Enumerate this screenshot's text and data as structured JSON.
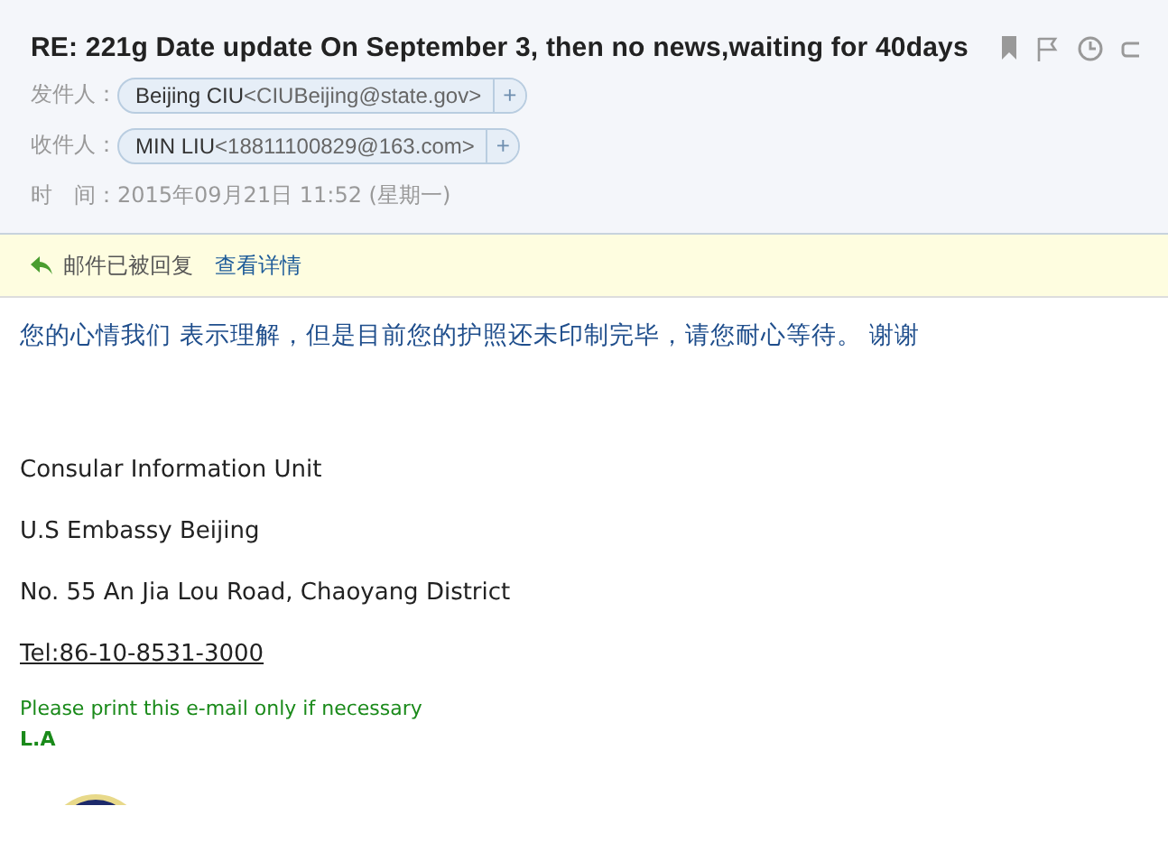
{
  "subject": "RE: 221g Date update On September 3, then no news,waiting for 40days",
  "sender": {
    "label": "发件人：",
    "name": "Beijing CIU",
    "address": "<CIUBeijing@state.gov>",
    "add": "+"
  },
  "recipient": {
    "label": "收件人：",
    "name": "MIN LIU",
    "address": "<18811100829@163.com>",
    "add": "+"
  },
  "time": {
    "label": "时　间：",
    "value": "2015年09月21日 11:52 (星期一)"
  },
  "notice": {
    "text": "邮件已被回复",
    "link": "查看详情"
  },
  "body": {
    "message": "您的心情我们 表示理解，但是目前您的护照还未印制完毕，请您耐心等待。 谢谢",
    "signature": [
      "Consular Information Unit",
      "U.S Embassy Beijing",
      "No. 55 An Jia Lou Road, Chaoyang District"
    ],
    "phone": "Tel:86-10-8531-3000",
    "footer": "Please print this e-mail only if necessary",
    "initials": "L.A"
  }
}
